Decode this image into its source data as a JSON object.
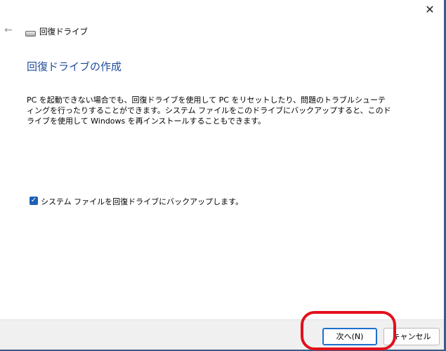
{
  "window": {
    "title": "回復ドライブ",
    "close_icon": "close-icon",
    "back_icon": "back-arrow-icon",
    "drive_icon": "drive-icon"
  },
  "main": {
    "heading": "回復ドライブの作成",
    "description": "PC を起動できない場合でも、回復ドライブを使用して PC をリセットしたり、問題のトラブルシューティングを行ったりすることができます。システム ファイルをこのドライブにバックアップすると、このドライブを使用して Windows を再インストールすることもできます。",
    "checkbox_label": "システム ファイルを回復ドライブにバックアップします。",
    "checkbox_checked": true
  },
  "footer": {
    "next_label": "次へ(N)",
    "cancel_label": "キャンセル"
  },
  "colors": {
    "heading": "#1e4c9c",
    "accent": "#1d5fb5",
    "annotation": "#e3101c"
  }
}
